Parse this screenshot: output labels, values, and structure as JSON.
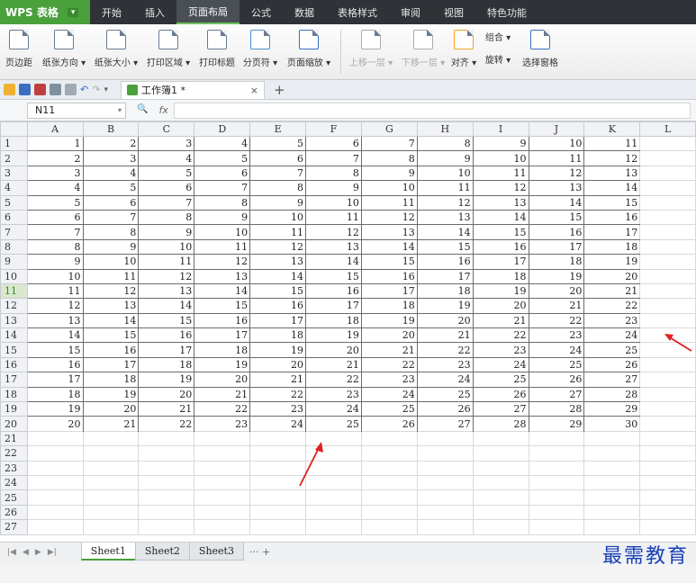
{
  "menubar": {
    "app_name": "WPS 表格",
    "tabs": [
      "开始",
      "插入",
      "页面布局",
      "公式",
      "数据",
      "表格样式",
      "审阅",
      "视图",
      "特色功能"
    ],
    "active_tab": "页面布局"
  },
  "ribbon": {
    "items": [
      {
        "id": "margin",
        "label": "页边距"
      },
      {
        "id": "orientation",
        "label": "纸张方向 ▾"
      },
      {
        "id": "paper-size",
        "label": "纸张大小 ▾"
      },
      {
        "id": "print-area",
        "label": "打印区域 ▾"
      },
      {
        "id": "print-titles",
        "label": "打印标题"
      },
      {
        "id": "page-break",
        "label": "分页符 ▾"
      },
      {
        "id": "page-zoom",
        "label": "页面缩放 ▾"
      },
      {
        "id": "bring-forward",
        "label": "上移一层 ▾",
        "disabled": true
      },
      {
        "id": "send-backward",
        "label": "下移一层 ▾",
        "disabled": true
      },
      {
        "id": "align",
        "label": "对齐 ▾"
      },
      {
        "id": "rotate",
        "label": "旋转 ▾"
      },
      {
        "id": "selection-pane",
        "label": "选择窗格"
      }
    ],
    "group_label": "组合 ▾"
  },
  "doc_tab": {
    "label": "工作簿1 *",
    "close": "×",
    "add": "+"
  },
  "formula_bar": {
    "name_box": "N11",
    "fx": "fx",
    "zoom_icon": "🔍"
  },
  "grid": {
    "columns": [
      "A",
      "B",
      "C",
      "D",
      "E",
      "F",
      "G",
      "H",
      "I",
      "J",
      "K",
      "L"
    ],
    "row_count": 27,
    "data_rows": 20,
    "data_cols": 11,
    "active_row": 11
  },
  "sheets": {
    "tabs": [
      "Sheet1",
      "Sheet2",
      "Sheet3"
    ],
    "active": "Sheet1",
    "more": "··· +"
  },
  "watermark": "最需教育",
  "colors": {
    "app_green": "#4aa03a",
    "menubar_bg": "#2f3338",
    "arrow_red": "#e02020"
  }
}
